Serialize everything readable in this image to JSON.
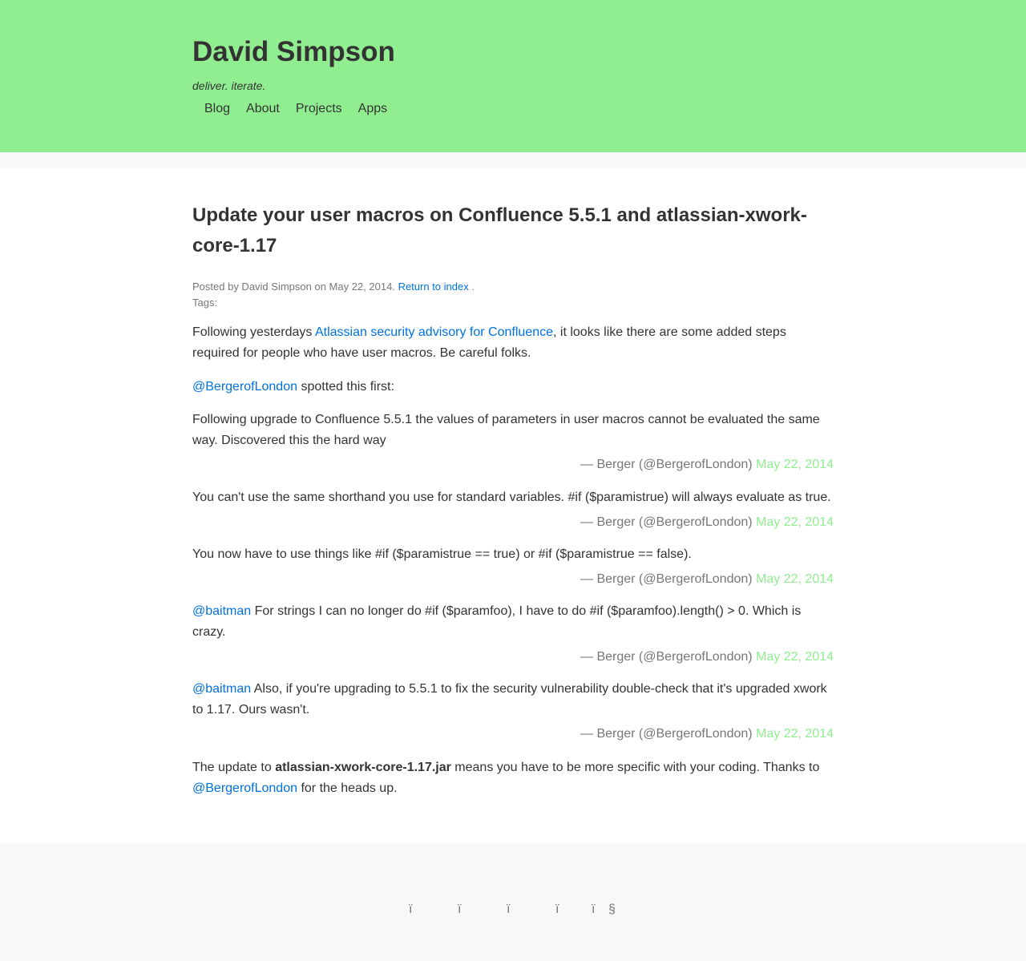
{
  "site": {
    "title": "David Simpson",
    "tagline": "deliver. iterate.",
    "nav": [
      "Blog",
      "About",
      "Projects",
      "Apps"
    ]
  },
  "post": {
    "title": "Update your user macros on Confluence 5.5.1 and atlassian-xwork-core-1.17",
    "meta_prefix": "Posted by David Simpson on May 22, 2014.",
    "return_link": "Return to index",
    "meta_suffix": ".",
    "tags_label": "Tags:",
    "p1_before": "Following yesterdays ",
    "p1_link": "Atlassian security advisory for Confluence",
    "p1_after": ", it looks like there are some added steps required for people who have user macros. Be careful folks.",
    "p2_link": "@BergerofLondon",
    "p2_after": " spotted this first:",
    "tweets": [
      {
        "mention": "",
        "text": "Following upgrade to Confluence 5.5.1 the values of parameters in user macros cannot be evaluated the same way. Discovered this the hard way",
        "attribution": "— Berger (@BergerofLondon)",
        "date": "May 22, 2014"
      },
      {
        "mention": "",
        "text": "You can't use the same shorthand you use for standard variables. #if ($paramistrue) will always evaluate as true.",
        "attribution": "— Berger (@BergerofLondon)",
        "date": "May 22, 2014"
      },
      {
        "mention": "",
        "text": "You now have to use things like #if ($paramistrue == true) or #if ($paramistrue == false).",
        "attribution": "— Berger (@BergerofLondon)",
        "date": "May 22, 2014"
      },
      {
        "mention": "@baitman",
        "text": " For strings I can no longer do #if ($paramfoo), I have to do #if ($paramfoo).length() > 0. Which is crazy.",
        "attribution": "— Berger (@BergerofLondon)",
        "date": "May 22, 2014"
      },
      {
        "mention": "@baitman",
        "text": " Also, if you're upgrading to 5.5.1 to fix the security vulnerability double-check that it's upgraded xwork to 1.17. Ours wasn't.",
        "attribution": "— Berger (@BergerofLondon)",
        "date": "May 22, 2014"
      }
    ],
    "final_before": "The update to ",
    "final_bold": "atlassian-xwork-core-1.17.jar",
    "final_middle": " means you have to be more specific with your coding. Thanks to ",
    "final_link": "@BergerofLondon",
    "final_after": " for the heads up."
  },
  "footer": {
    "icons": [
      "ï",
      "ï",
      "ï",
      "ï",
      "ï",
      "§"
    ]
  },
  "colors": {
    "header_bg": "#90ee90",
    "link": "#0071e0",
    "date_link": "#90ee90"
  }
}
